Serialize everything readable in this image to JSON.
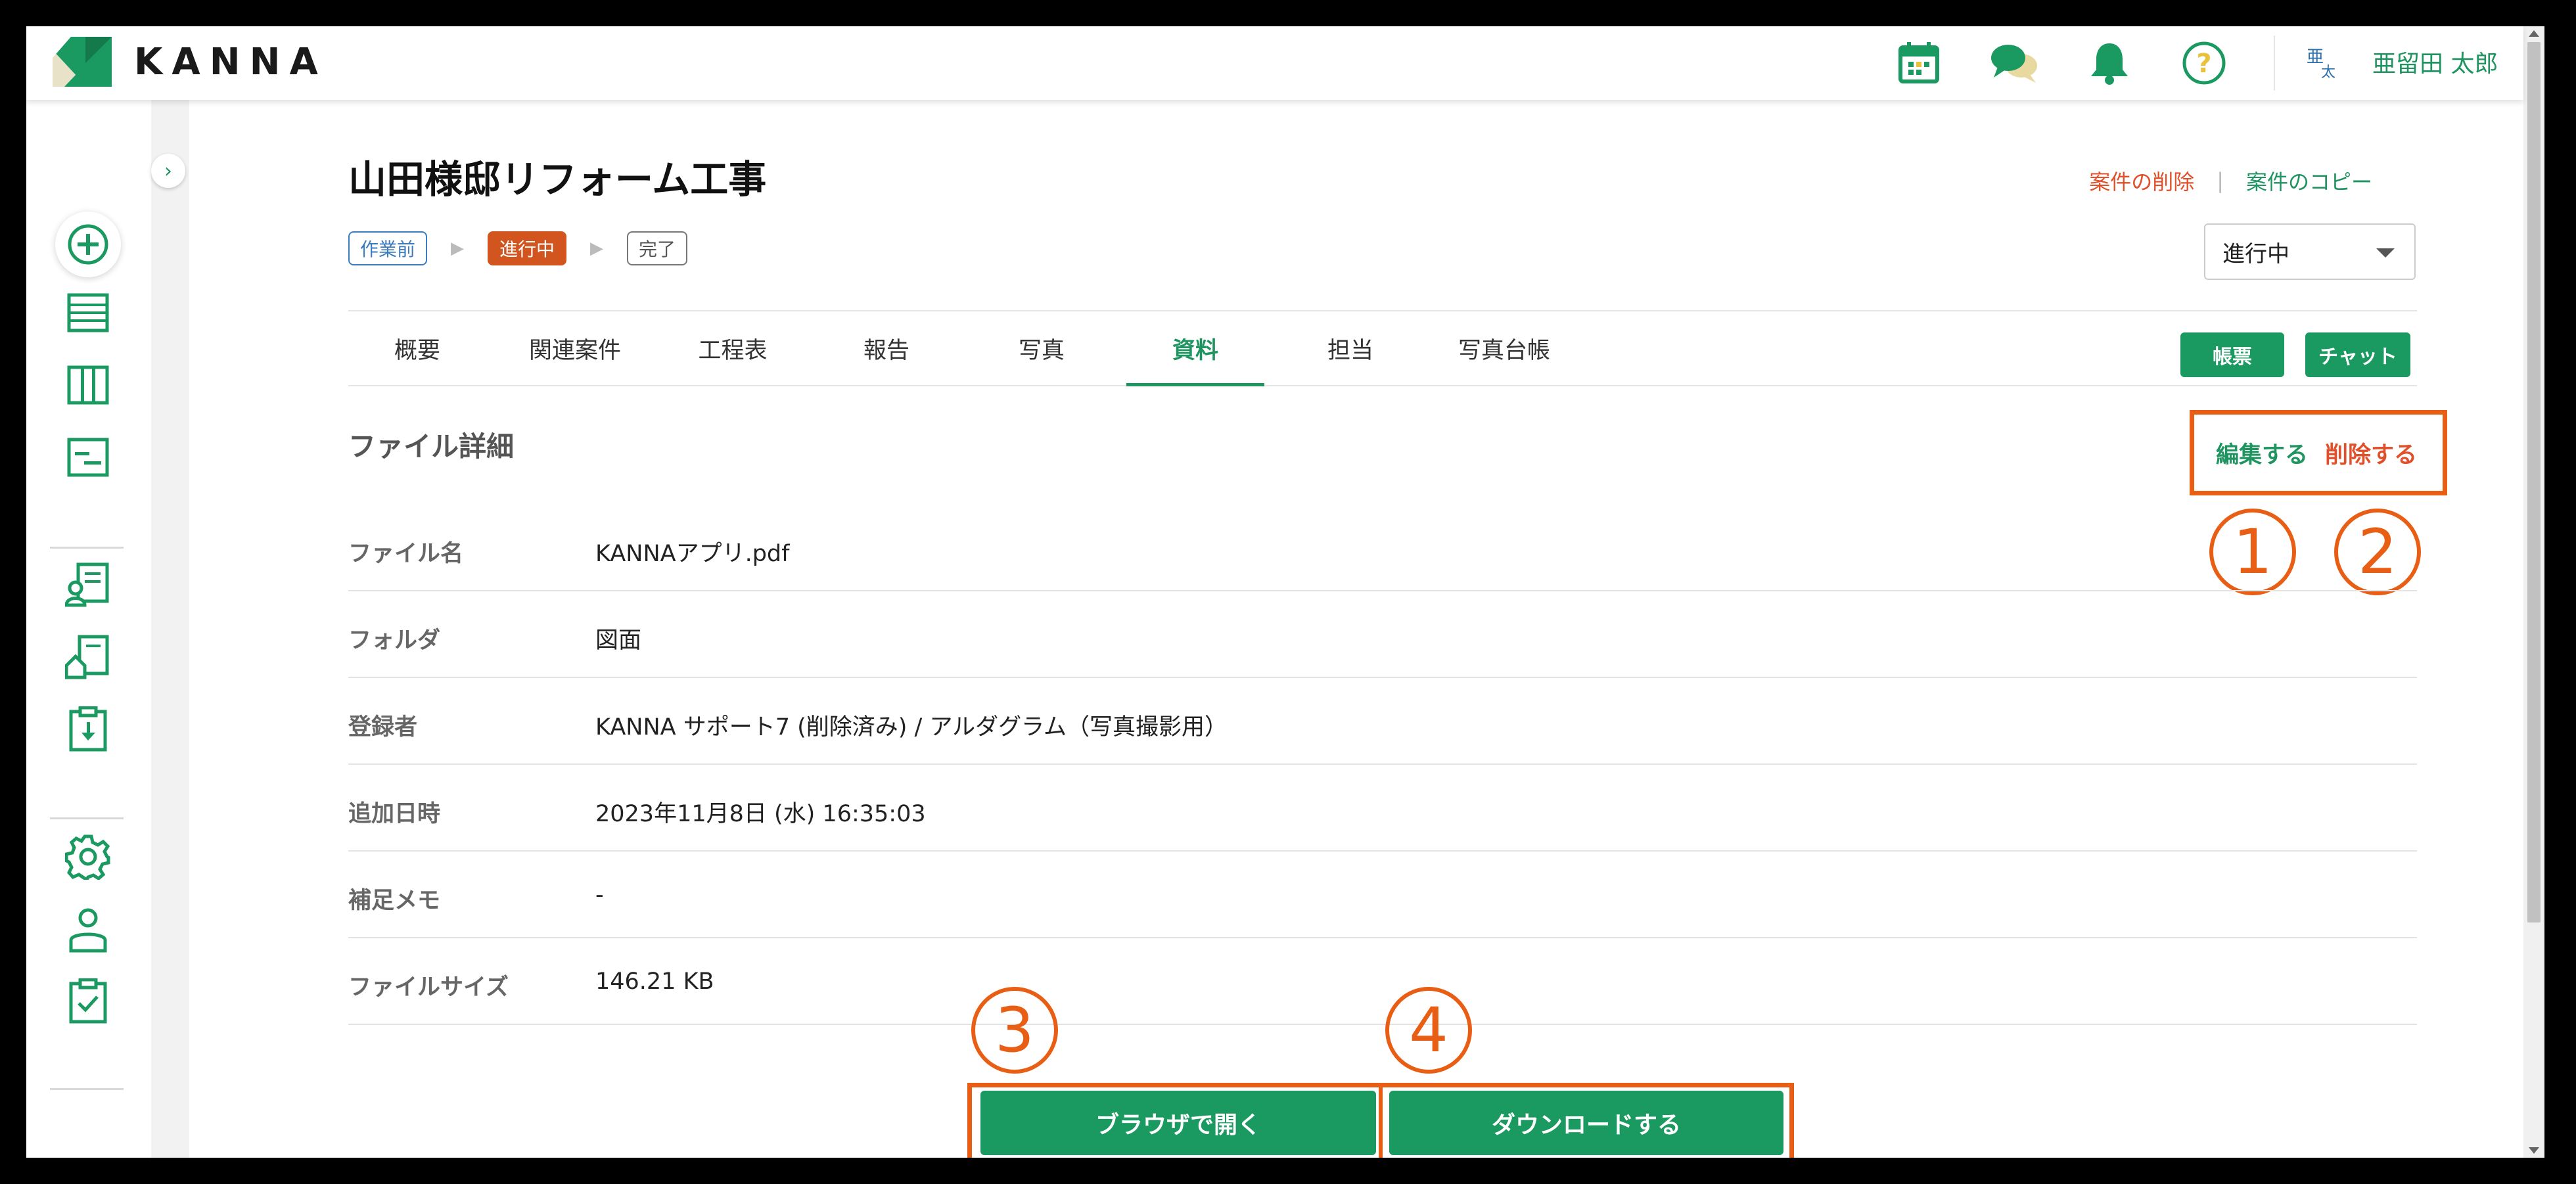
{
  "header": {
    "brand": "KANNA",
    "icons": [
      "calendar-icon",
      "chat-icon",
      "bell-icon",
      "help-icon"
    ],
    "avatar_chars": [
      "亜",
      "太"
    ],
    "user_name": "亜留田 太郎"
  },
  "sidebar": {
    "collapse_glyph": "›",
    "icons": [
      "add-circle-icon",
      "list-icon",
      "board-icon",
      "gantt-icon",
      "customer-doc-icon",
      "building-doc-icon",
      "download-doc-icon",
      "gear-icon",
      "user-icon",
      "clipboard-check-icon"
    ]
  },
  "project": {
    "title": "山田様邸リフォーム工事",
    "delete_label": "案件の削除",
    "separator": "|",
    "copy_label": "案件のコピー",
    "steps": [
      "作業前",
      "進行中",
      "完了"
    ],
    "status_value": "進行中"
  },
  "tabs": [
    "概要",
    "関連案件",
    "工程表",
    "報告",
    "写真",
    "資料",
    "担当",
    "写真台帳"
  ],
  "active_tab": "資料",
  "tab_buttons": {
    "report": "帳票",
    "chat": "チャット"
  },
  "file_detail": {
    "section_title": "ファイル詳細",
    "edit_label": "編集する",
    "delete_label": "削除する",
    "rows": [
      {
        "label": "ファイル名",
        "value": "KANNAアプリ.pdf"
      },
      {
        "label": "フォルダ",
        "value": "図面"
      },
      {
        "label": "登録者",
        "value": "KANNA サポート7 (削除済み) / アルダグラム（写真撮影用）"
      },
      {
        "label": "追加日時",
        "value": "2023年11月8日 (水) 16:35:03"
      },
      {
        "label": "補足メモ",
        "value": "-"
      },
      {
        "label": "ファイルサイズ",
        "value": "146.21 KB"
      }
    ],
    "open_browser_label": "ブラウザで開く",
    "download_label": "ダウンロードする"
  },
  "annotations": {
    "one": "1",
    "two": "2",
    "three": "3",
    "four": "4"
  },
  "colors": {
    "brand_green": "#1a9960",
    "accent_orange": "#e85e15",
    "status_active": "#d2551f",
    "link_red": "#e0502a",
    "link_blue": "#3b7bbf"
  }
}
